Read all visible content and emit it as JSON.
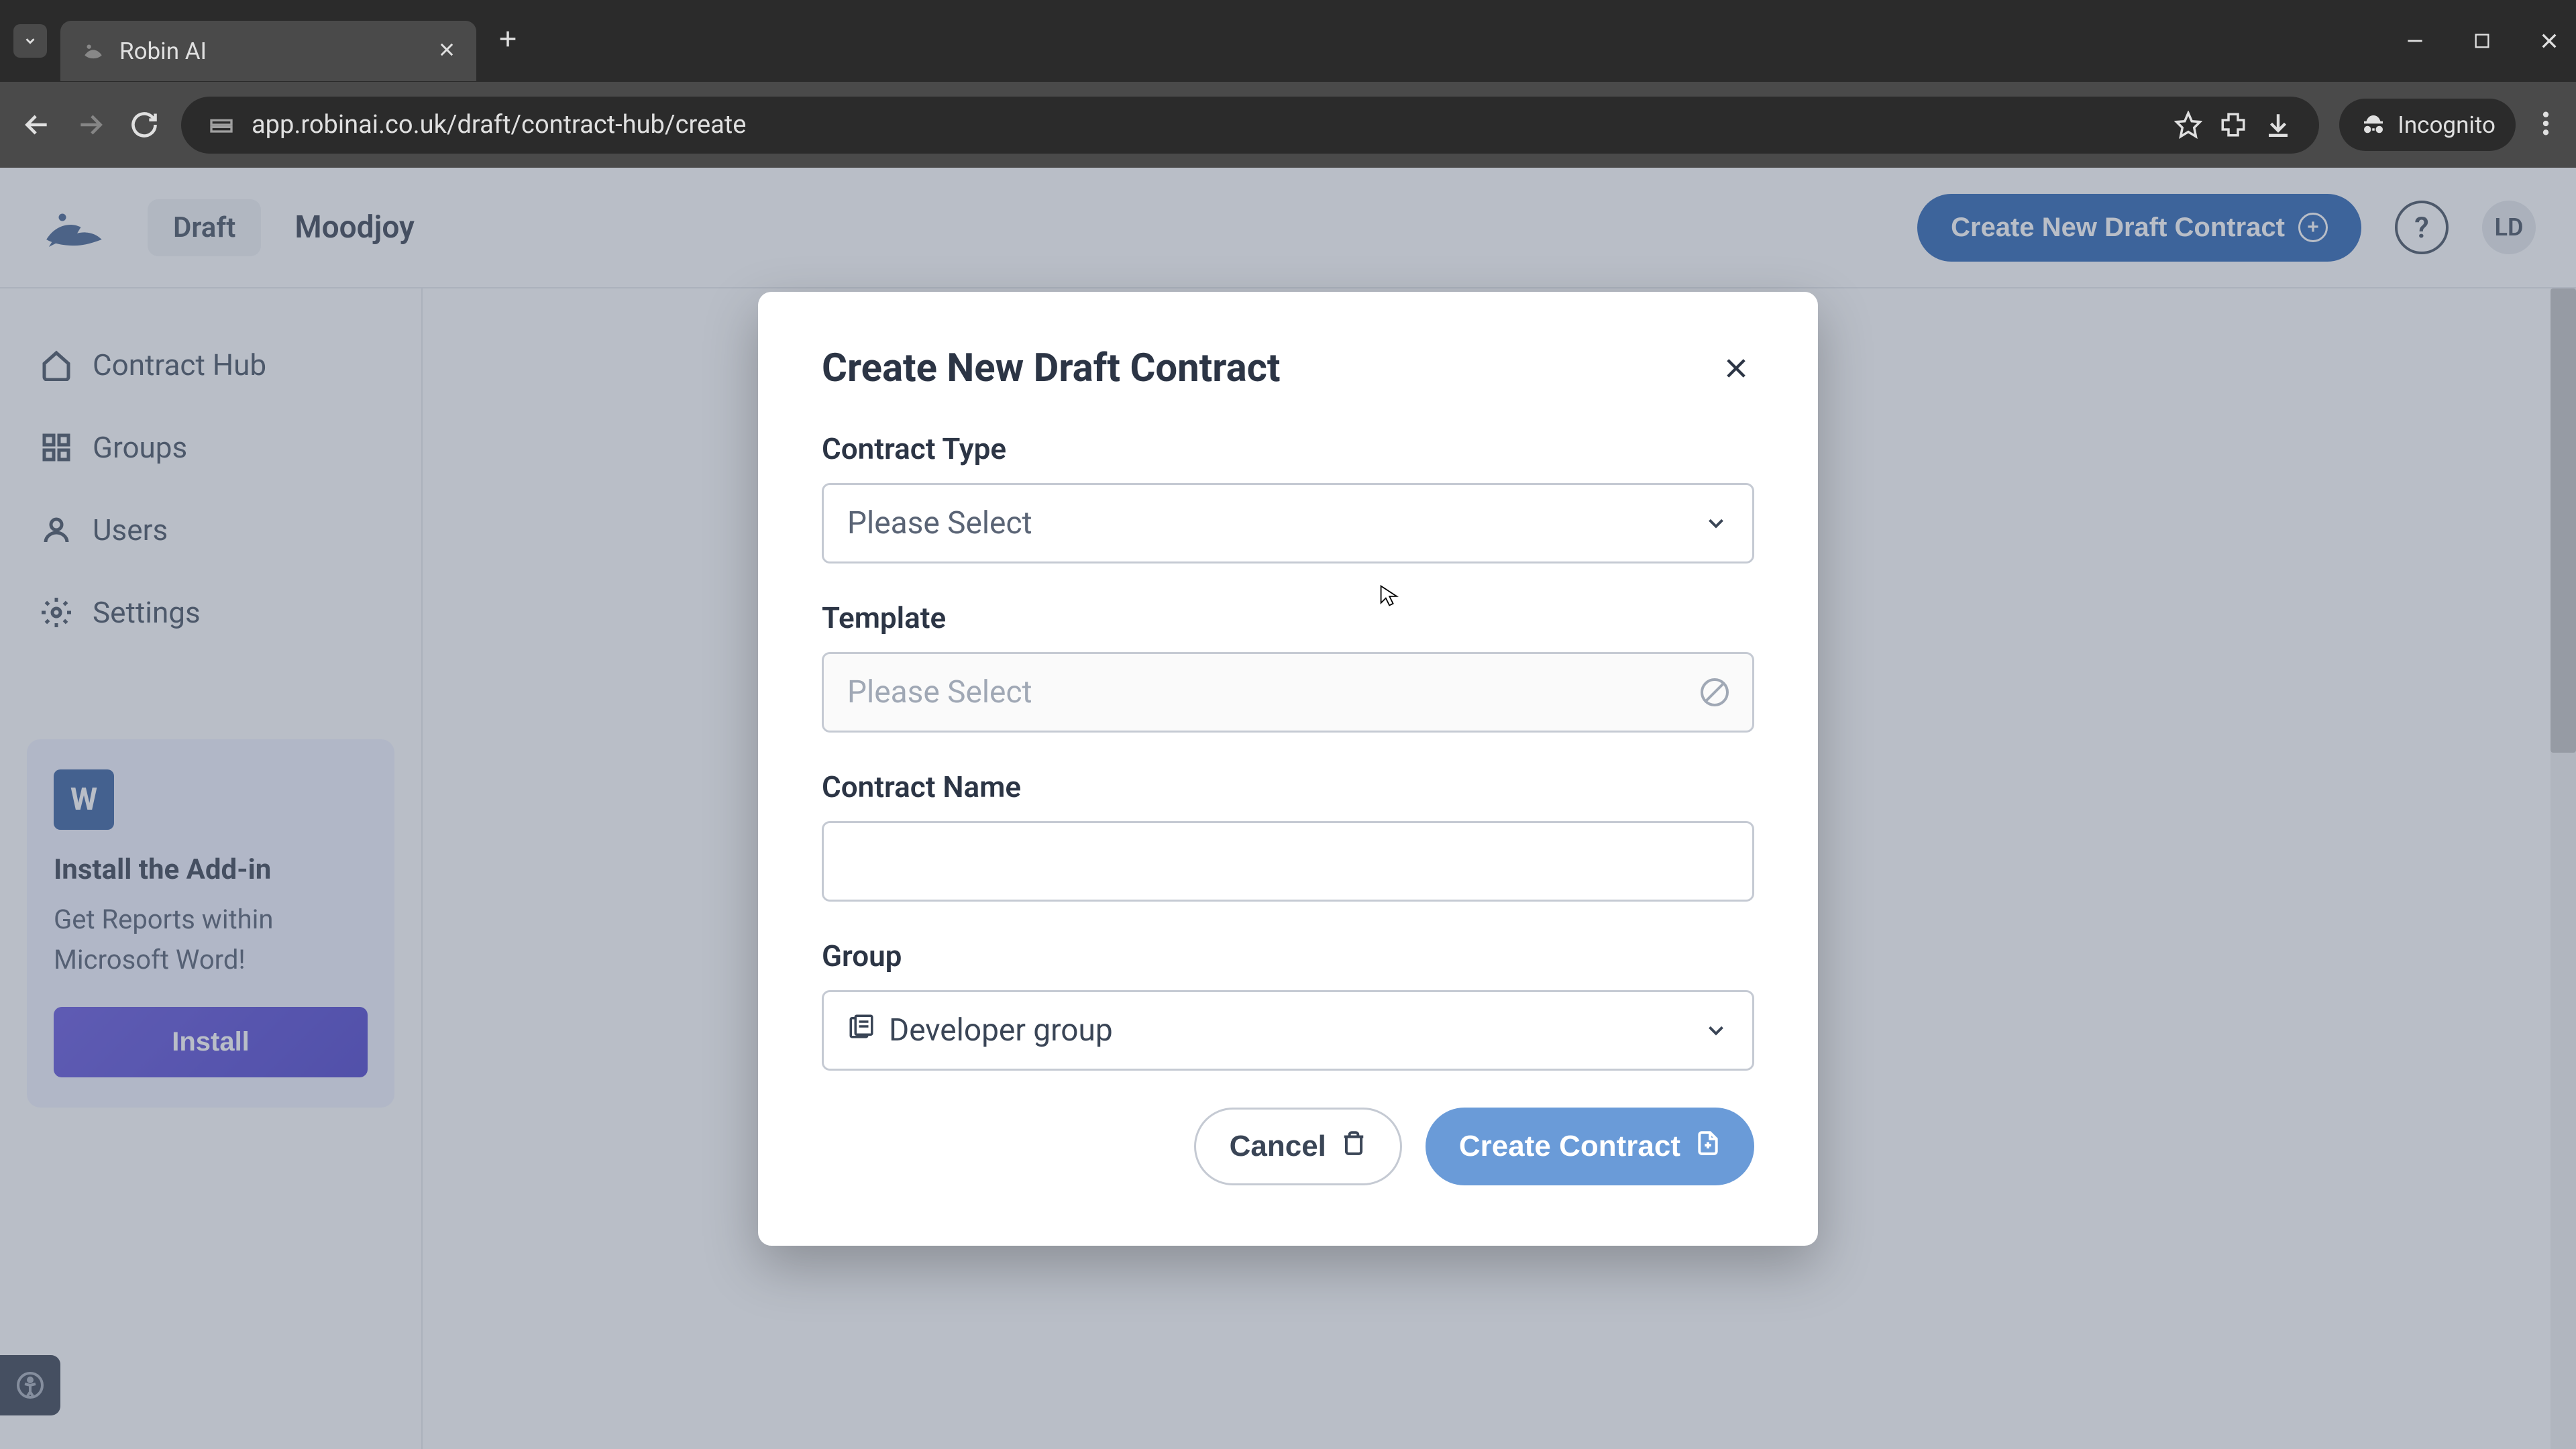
{
  "browser": {
    "tab_title": "Robin AI",
    "url": "app.robinai.co.uk/draft/contract-hub/create",
    "incognito_label": "Incognito"
  },
  "header": {
    "draft_label": "Draft",
    "breadcrumb": "Moodjoy",
    "create_button": "Create New Draft Contract",
    "avatar_initials": "LD"
  },
  "sidebar": {
    "items": [
      {
        "label": "Contract Hub"
      },
      {
        "label": "Groups"
      },
      {
        "label": "Users"
      },
      {
        "label": "Settings"
      }
    ],
    "addin": {
      "title": "Install the Add-in",
      "desc": "Get Reports within Microsoft Word!",
      "button": "Install"
    }
  },
  "modal": {
    "title": "Create New Draft Contract",
    "fields": {
      "contract_type": {
        "label": "Contract Type",
        "placeholder": "Please Select"
      },
      "template": {
        "label": "Template",
        "placeholder": "Please Select"
      },
      "contract_name": {
        "label": "Contract Name",
        "value": ""
      },
      "group": {
        "label": "Group",
        "value": "Developer group"
      }
    },
    "cancel": "Cancel",
    "submit": "Create Contract"
  }
}
